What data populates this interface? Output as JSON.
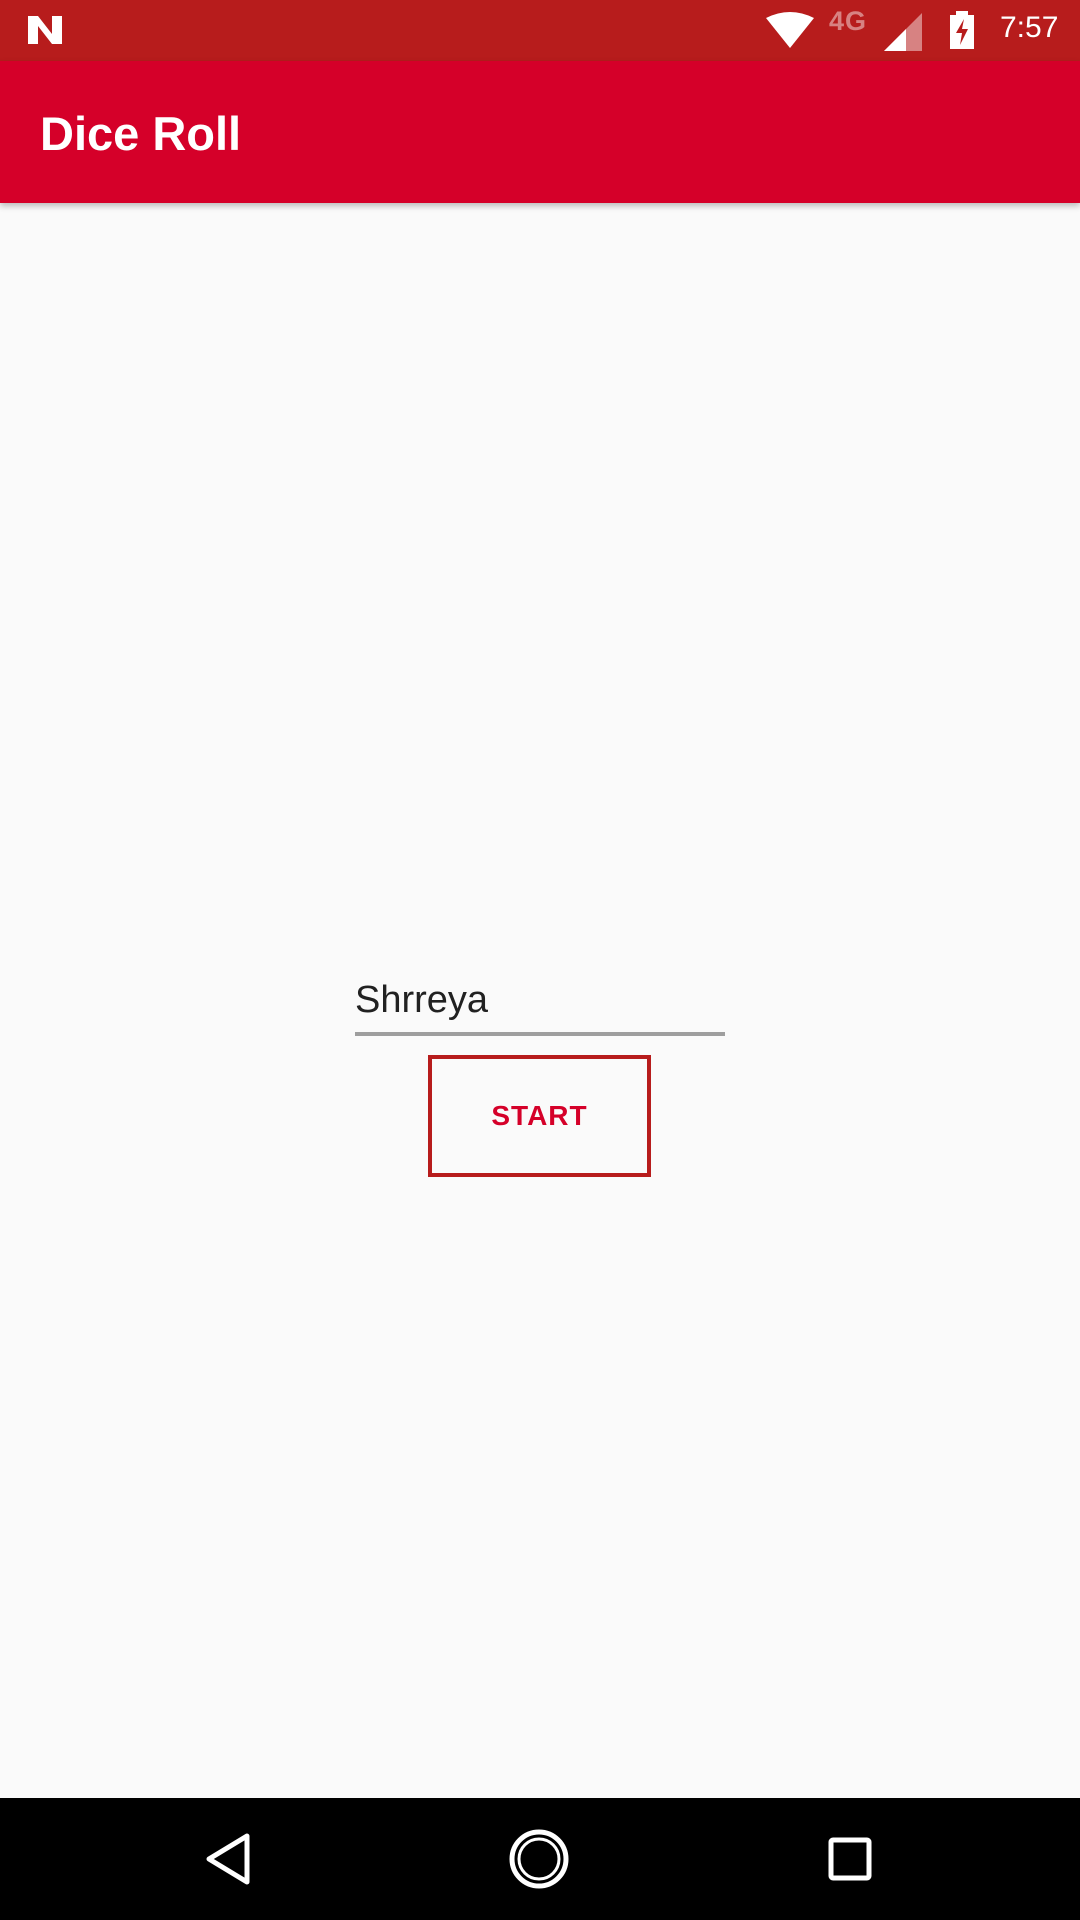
{
  "status_bar": {
    "network_type": "4G",
    "time": "7:57",
    "icons": [
      "n-logo-icon",
      "wifi-icon",
      "cell-signal-icon",
      "battery-charging-icon"
    ]
  },
  "app_bar": {
    "title": "Dice Roll"
  },
  "form": {
    "name_value": "Shrreya",
    "start_label": "START"
  },
  "nav_bar": {
    "icons": [
      "back-icon",
      "home-icon",
      "recents-icon"
    ]
  },
  "colors": {
    "status_bar": "#b71c1c",
    "app_bar": "#d50029",
    "background": "#fafafa",
    "button_border": "#b71c1c",
    "button_text": "#d50029"
  }
}
